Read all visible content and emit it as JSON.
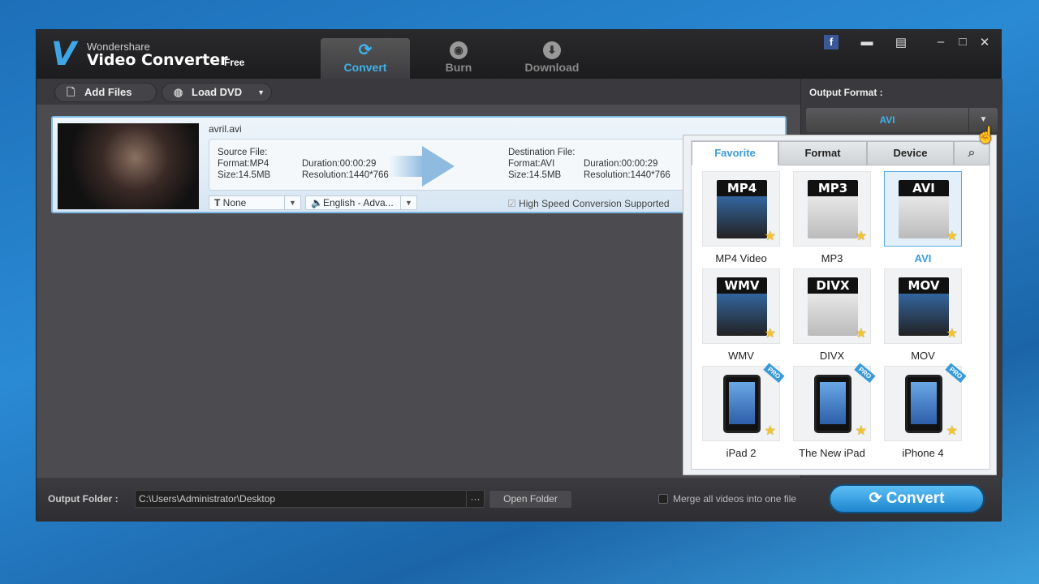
{
  "app": {
    "brand_line1": "Wondershare",
    "brand_line2": "Video Converter",
    "edition": "Free"
  },
  "tabs": [
    {
      "label": "Convert",
      "active": true
    },
    {
      "label": "Burn"
    },
    {
      "label": "Download"
    }
  ],
  "toolbar": {
    "add_files": "Add Files",
    "load_dvd": "Load DVD"
  },
  "file": {
    "name": "avril.avi",
    "source_label": "Source File:",
    "source_format": "Format:MP4",
    "source_size": "Size:14.5MB",
    "source_duration": "Duration:00:00:29",
    "source_resolution": "Resolution:1440*766",
    "dest_label": "Destination File:",
    "dest_format": "Format:AVI",
    "dest_size": "Size:14.5MB",
    "dest_duration": "Duration:00:00:29",
    "dest_resolution": "Resolution:1440*766",
    "subtitle": "None",
    "audio": "English - Adva...",
    "high_speed": "High Speed Conversion Supported"
  },
  "output_format": {
    "label": "Output Format :",
    "value": "AVI"
  },
  "popup": {
    "tabs": [
      "Favorite",
      "Format",
      "Device"
    ],
    "items": [
      {
        "hdr": "MP4",
        "name": "MP4 Video"
      },
      {
        "hdr": "MP3",
        "name": "MP3"
      },
      {
        "hdr": "AVI",
        "name": "AVI",
        "selected": true
      },
      {
        "hdr": "WMV",
        "name": "WMV"
      },
      {
        "hdr": "DIVX",
        "name": "DIVX"
      },
      {
        "hdr": "MOV",
        "name": "MOV"
      },
      {
        "hdr": "",
        "name": "iPad 2",
        "pro": "PRO"
      },
      {
        "hdr": "",
        "name": "The New iPad",
        "pro": "PRO"
      },
      {
        "hdr": "",
        "name": "iPhone 4",
        "pro": "PRO"
      }
    ]
  },
  "bottom": {
    "output_folder_label": "Output Folder :",
    "output_folder": "C:\\Users\\Administrator\\Desktop",
    "browse": "···",
    "open_folder": "Open Folder",
    "merge": "Merge all videos into one file",
    "convert": "Convert"
  }
}
